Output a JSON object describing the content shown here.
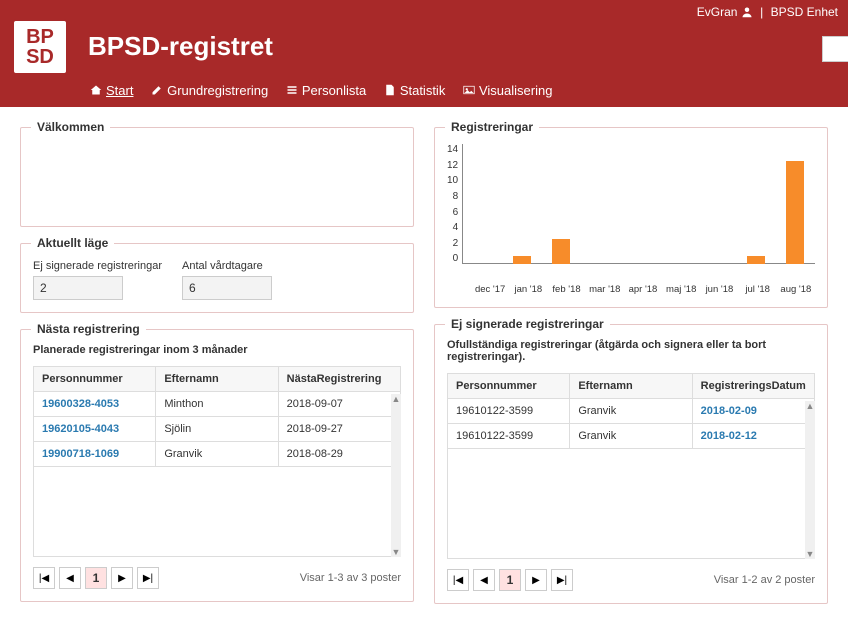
{
  "header": {
    "user": "EvGran",
    "org": "BPSD Enhet",
    "logo_top": "BP",
    "logo_bot": "SD",
    "title": "BPSD-registret",
    "nav": {
      "start": "Start",
      "grund": "Grundregistrering",
      "person": "Personlista",
      "stat": "Statistik",
      "vis": "Visualisering"
    }
  },
  "welcome_panel": {
    "title": "Välkommen"
  },
  "status_panel": {
    "title": "Aktuellt läge",
    "unsigned_label": "Ej signerade registreringar",
    "unsigned_value": "2",
    "patients_label": "Antal vårdtagare",
    "patients_value": "6"
  },
  "next_panel": {
    "title": "Nästa registrering",
    "sub": "Planerade registreringar inom 3 månader",
    "columns": {
      "c1": "Personnummer",
      "c2": "Efternamn",
      "c3": "NästaRegistrering"
    },
    "rows": [
      {
        "pn": "19600328-4053",
        "name": "Minthon",
        "date": "2018-09-07"
      },
      {
        "pn": "19620105-4043",
        "name": "Sjölin",
        "date": "2018-09-27"
      },
      {
        "pn": "19900718-1069",
        "name": "Granvik",
        "date": "2018-08-29"
      }
    ],
    "pager_info": "Visar 1-3 av 3 poster",
    "page_num": "1"
  },
  "unsigned_panel": {
    "title": "Ej signerade registreringar",
    "sub": "Ofullständiga registreringar (åtgärda och signera eller ta bort registreringar).",
    "columns": {
      "c1": "Personnummer",
      "c2": "Efternamn",
      "c3": "RegistreringsDatum"
    },
    "rows": [
      {
        "pn": "19610122-3599",
        "name": "Granvik",
        "date": "2018-02-09"
      },
      {
        "pn": "19610122-3599",
        "name": "Granvik",
        "date": "2018-02-12"
      }
    ],
    "pager_info": "Visar 1-2 av 2 poster",
    "page_num": "1"
  },
  "chart_panel": {
    "title": "Registreringar"
  },
  "chart_data": {
    "type": "bar",
    "title": "Registreringar",
    "xlabel": "",
    "ylabel": "",
    "ylim": [
      0,
      14
    ],
    "yticks": [
      0,
      2,
      4,
      6,
      8,
      10,
      12,
      14
    ],
    "categories": [
      "dec '17",
      "jan '18",
      "feb '18",
      "mar '18",
      "apr '18",
      "maj '18",
      "jun '18",
      "jul '18",
      "aug '18"
    ],
    "values": [
      0,
      1,
      3,
      0,
      0,
      0,
      0,
      1,
      12
    ]
  }
}
